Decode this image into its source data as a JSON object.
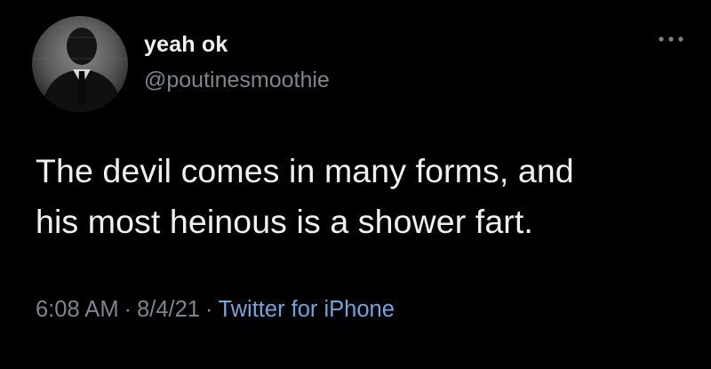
{
  "tweet": {
    "display_name": "yeah ok",
    "handle": "@poutinesmoothie",
    "text_lines": [
      "The devil comes in many forms, and",
      "his most heinous is a shower fart."
    ],
    "time": "6:08 AM",
    "date": "8/4/21",
    "separator": "·",
    "source": "Twitter for iPhone"
  },
  "icons": {
    "more": "more-options-icon",
    "avatar": "profile-avatar"
  },
  "colors": {
    "background": "#000000",
    "primary_text": "#eef0f2",
    "secondary_text": "#7d858d",
    "link": "#6ea7dd"
  }
}
